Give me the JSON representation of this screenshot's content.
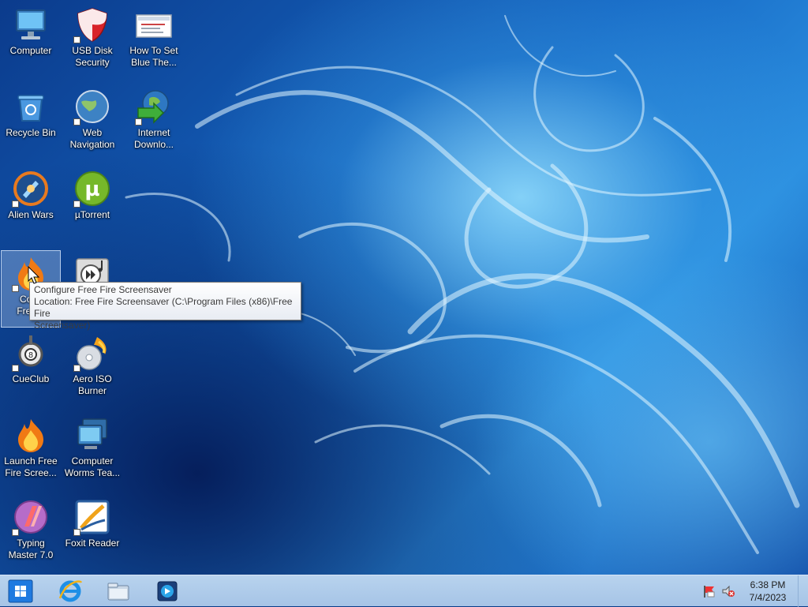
{
  "desktop": {
    "icons": [
      {
        "name": "Computer",
        "lines": [
          "Computer"
        ]
      },
      {
        "name": "USB Disk Security",
        "lines": [
          "USB Disk",
          "Security"
        ]
      },
      {
        "name": "How To Set Blue The...",
        "lines": [
          "How To Set",
          "Blue The..."
        ]
      },
      {
        "name": "Recycle Bin",
        "lines": [
          "Recycle Bin"
        ]
      },
      {
        "name": "Web Navigation",
        "lines": [
          "Web",
          "Navigation"
        ]
      },
      {
        "name": "Internet Downlo...",
        "lines": [
          "Internet",
          "Downlo..."
        ]
      },
      {
        "name": "Alien Wars",
        "lines": [
          "Alien Wars"
        ]
      },
      {
        "name": "µTorrent",
        "lines": [
          "µTorrent"
        ]
      },
      {
        "name": "Configure Free Fire Screensaver",
        "lines": [
          "Confi",
          "Free F"
        ]
      },
      {
        "name": "Media Player",
        "lines": [
          ""
        ]
      },
      {
        "name": "CueClub",
        "lines": [
          "CueClub"
        ]
      },
      {
        "name": "Aero ISO Burner",
        "lines": [
          "Aero ISO",
          "Burner"
        ]
      },
      {
        "name": "Launch Free Fire Scree...",
        "lines": [
          "Launch Free",
          "Fire Scree..."
        ]
      },
      {
        "name": "Computer Worms Tea...",
        "lines": [
          "Computer",
          "Worms Tea..."
        ]
      },
      {
        "name": "Typing Master 7.0",
        "lines": [
          "Typing",
          "Master 7.0"
        ]
      },
      {
        "name": "Foxit Reader",
        "lines": [
          "Foxit Reader"
        ]
      }
    ]
  },
  "tooltip": {
    "title": "Configure Free Fire Screensaver",
    "location_line1": "Location: Free Fire Screensaver (C:\\Program Files (x86)\\Free Fire",
    "location_line2": "Screensaver)"
  },
  "taskbar": {
    "pinned": [
      "start-icon",
      "internet-explorer-icon",
      "file-explorer-icon",
      "media-player-icon"
    ],
    "clock": {
      "time": "6:38 PM",
      "date": "7/4/2023"
    }
  },
  "colors": {
    "taskbar": "#a9c6e8",
    "accent": "#1e73d9"
  }
}
